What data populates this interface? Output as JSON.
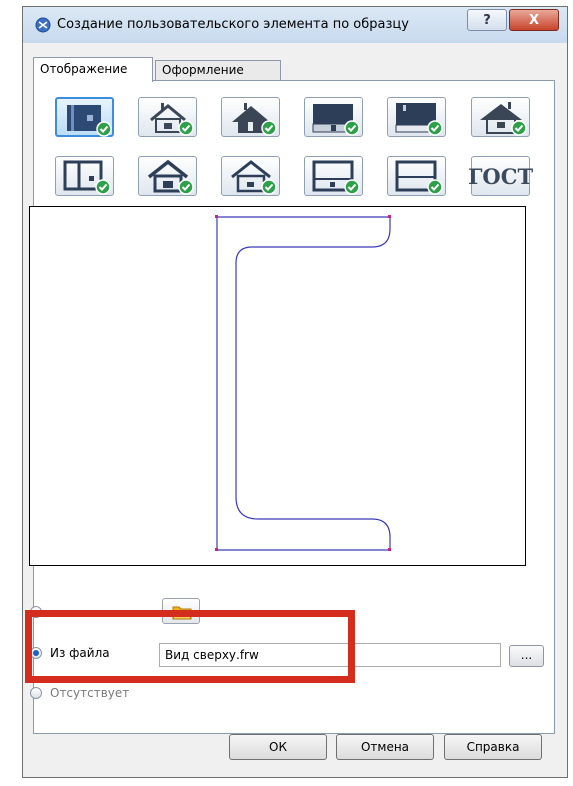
{
  "window": {
    "title": "Создание пользовательского элемента по образцу",
    "help_button": "?",
    "close_button": "X"
  },
  "tabs": [
    {
      "label": "Отображение",
      "active": true
    },
    {
      "label": "Оформление",
      "active": false
    }
  ],
  "templates": {
    "row1": [
      "profile-section-icon",
      "house-chimney-icon",
      "house-door-icon",
      "wall-block-icon",
      "wall-window-icon",
      "roof-house-icon"
    ],
    "row2": [
      "frame-icon",
      "house-filled-icon",
      "house-outline-icon",
      "box-panel-icon",
      "box-outline-icon",
      "gost-label"
    ],
    "gost_label": "ГОСТ",
    "selected_index": 0,
    "accent_color": "#3c8edb",
    "check_color": "#2ea04a"
  },
  "preview": {
    "shape": "channel-profile",
    "line_color": "#3b3bb8",
    "marker_color": "#cc2288"
  },
  "source_options": {
    "option1_label": "Из файла",
    "option2_label": "Отсутствует",
    "selected": "Из файла",
    "file_value": "Вид сверху.frw",
    "browse_label": "..."
  },
  "buttons": {
    "ok": "ОК",
    "cancel": "Отмена",
    "help": "Справка"
  },
  "highlight_color": "#d42d1d"
}
